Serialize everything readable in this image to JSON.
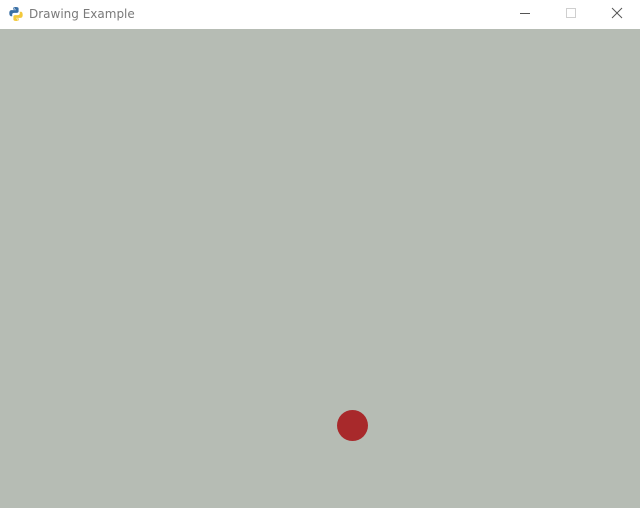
{
  "window": {
    "title": "Drawing Example",
    "icon": "python-icon",
    "controls": [
      "minimize-icon",
      "maximize-icon",
      "close-icon"
    ]
  },
  "canvas": {
    "background": "#b6bcb4",
    "ball": {
      "color": "#a8292b",
      "shape": "circle"
    }
  }
}
